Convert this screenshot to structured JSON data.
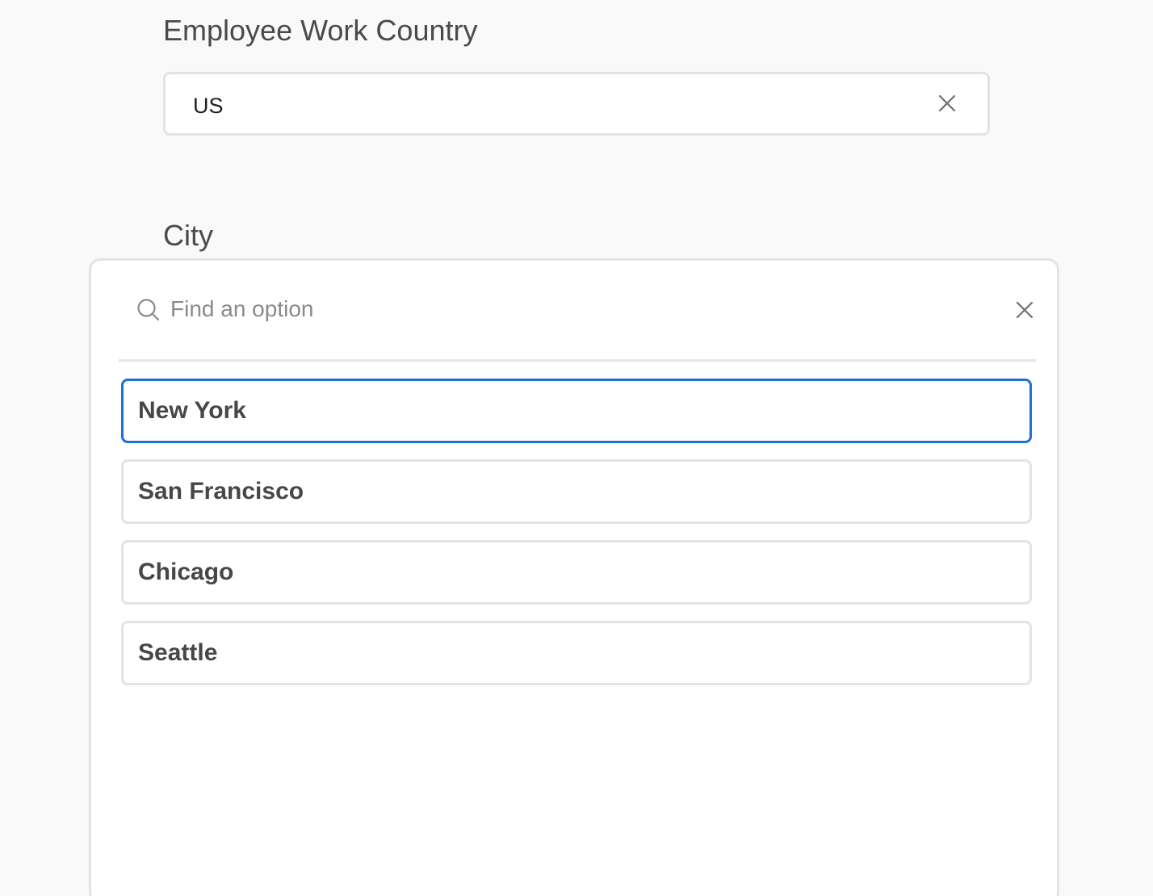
{
  "country_field": {
    "label": "Employee Work Country",
    "value": "US"
  },
  "city_field": {
    "label": "City",
    "search_placeholder": "Find an option",
    "focused_option": 0,
    "options": [
      "New York",
      "San Francisco",
      "Chicago",
      "Seattle"
    ]
  },
  "colors": {
    "focus_border": "#1f6fd8",
    "border": "#e3e3e3",
    "label_text": "#4a4a4a"
  }
}
